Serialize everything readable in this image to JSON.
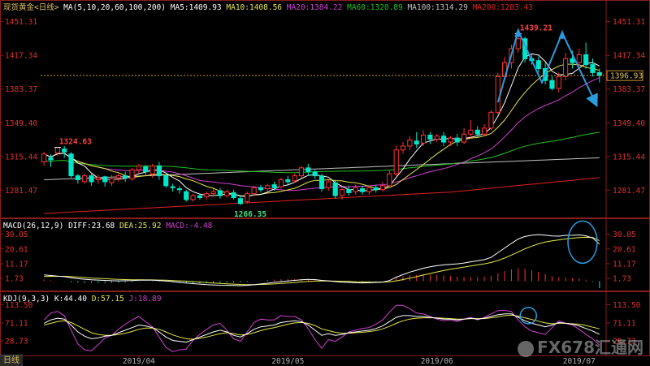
{
  "window": {
    "bottom_tab": "日线",
    "watermark": "FX678汇通网"
  },
  "colors": {
    "up": "#ff3232",
    "down": "#00e6c8",
    "ma5": "#ffffff",
    "ma10": "#e6e64b",
    "ma20": "#d040d0",
    "ma60": "#20c020",
    "ma100": "#c0c0c0",
    "ma200": "#e02020",
    "annotation": "#2b9be0",
    "price_line": "#c89632",
    "axis_text": "#e03030"
  },
  "chart_data": [
    {
      "type": "candlestick",
      "panel": "price",
      "title": "现货黄金<日线>",
      "ma_label": "MA(5,10,20,60,100,200)",
      "ma_values": [
        {
          "label": "MA5:1409.93",
          "color": "#ffffff"
        },
        {
          "label": "MA10:1408.56",
          "color": "#e6e64b"
        },
        {
          "label": "MA20:1384.22",
          "color": "#d040d0"
        },
        {
          "label": "MA60:1320.89",
          "color": "#20c020"
        },
        {
          "label": "MA100:1314.29",
          "color": "#c0c0c0"
        },
        {
          "label": "MA200:1283.43",
          "color": "#e02020"
        }
      ],
      "yticks": [
        1451.31,
        1417.34,
        1383.37,
        1349.4,
        1315.44,
        1281.47
      ],
      "ylim": [
        1254,
        1460
      ],
      "xticks": [
        {
          "label": "2019/04",
          "index": 14
        },
        {
          "label": "2019/05",
          "index": 36
        },
        {
          "label": "2019/06",
          "index": 58
        },
        {
          "label": "2019/07",
          "index": 79
        }
      ],
      "current_price": 1396.93,
      "annotations": [
        {
          "text": "1324.63",
          "index": 2,
          "value": 1324.63,
          "side": "above"
        },
        {
          "text": "1266.35",
          "index": 29,
          "value": 1266.35,
          "side": "below"
        },
        {
          "text": "1439.21",
          "index": 70,
          "value": 1439.21,
          "side": "above"
        }
      ],
      "candles": [
        [
          1310,
          1318,
          1306,
          1320
        ],
        [
          1314,
          1312,
          1305,
          1318
        ],
        [
          1319,
          1324.6,
          1316,
          1325
        ],
        [
          1323,
          1320,
          1314,
          1326
        ],
        [
          1318,
          1296,
          1294,
          1320
        ],
        [
          1296,
          1292,
          1288,
          1298
        ],
        [
          1290,
          1296,
          1288,
          1298
        ],
        [
          1296,
          1290,
          1286,
          1299
        ],
        [
          1292,
          1294,
          1288,
          1297
        ],
        [
          1295,
          1290,
          1285,
          1296
        ],
        [
          1289,
          1293,
          1286,
          1297
        ],
        [
          1294,
          1296,
          1290,
          1298
        ],
        [
          1296,
          1294,
          1290,
          1300
        ],
        [
          1293,
          1302,
          1291,
          1304
        ],
        [
          1302,
          1306,
          1299,
          1308
        ],
        [
          1305,
          1300,
          1297,
          1307
        ],
        [
          1298,
          1306,
          1294,
          1308
        ],
        [
          1306,
          1296,
          1292,
          1310
        ],
        [
          1296,
          1286,
          1284,
          1298
        ],
        [
          1285,
          1284,
          1280,
          1288
        ],
        [
          1283,
          1282,
          1278,
          1286
        ],
        [
          1280,
          1272,
          1270,
          1282
        ],
        [
          1272,
          1276,
          1270,
          1278
        ],
        [
          1276,
          1274,
          1272,
          1278
        ],
        [
          1275,
          1278,
          1272,
          1280
        ],
        [
          1278,
          1280,
          1275,
          1283
        ],
        [
          1281,
          1276,
          1273,
          1284
        ],
        [
          1276,
          1280,
          1274,
          1282
        ],
        [
          1279,
          1274,
          1272,
          1282
        ],
        [
          1273,
          1268,
          1266.4,
          1276
        ],
        [
          1270,
          1278,
          1268,
          1280
        ],
        [
          1278,
          1284,
          1276,
          1286
        ],
        [
          1284,
          1282,
          1279,
          1287
        ],
        [
          1283,
          1286,
          1280,
          1288
        ],
        [
          1287,
          1284,
          1281,
          1290
        ],
        [
          1285,
          1292,
          1283,
          1294
        ],
        [
          1292,
          1290,
          1287,
          1296
        ],
        [
          1291,
          1296,
          1289,
          1298
        ],
        [
          1296,
          1304,
          1294,
          1306
        ],
        [
          1304,
          1300,
          1296,
          1308
        ],
        [
          1300,
          1296,
          1293,
          1302
        ],
        [
          1296,
          1283,
          1280,
          1298
        ],
        [
          1284,
          1290,
          1281,
          1292
        ],
        [
          1289,
          1276,
          1273,
          1292
        ],
        [
          1276,
          1282,
          1272,
          1284
        ],
        [
          1282,
          1279,
          1276,
          1286
        ],
        [
          1280,
          1284,
          1277,
          1287
        ],
        [
          1283,
          1280,
          1277,
          1286
        ],
        [
          1280,
          1284,
          1277,
          1286
        ],
        [
          1284,
          1282,
          1279,
          1287
        ],
        [
          1282,
          1286,
          1280,
          1290
        ],
        [
          1286,
          1298,
          1284,
          1302
        ],
        [
          1298,
          1322,
          1296,
          1326
        ],
        [
          1322,
          1326,
          1318,
          1330
        ],
        [
          1326,
          1332,
          1322,
          1336
        ],
        [
          1331,
          1328,
          1324,
          1340
        ],
        [
          1329,
          1337,
          1326,
          1342
        ],
        [
          1337,
          1333,
          1328,
          1340
        ],
        [
          1333,
          1336,
          1330,
          1338
        ],
        [
          1336,
          1330,
          1326,
          1340
        ],
        [
          1330,
          1334,
          1326,
          1336
        ],
        [
          1334,
          1330,
          1326,
          1338
        ],
        [
          1330,
          1338,
          1328,
          1344
        ],
        [
          1338,
          1342,
          1334,
          1352
        ],
        [
          1342,
          1338,
          1334,
          1346
        ],
        [
          1338,
          1344,
          1336,
          1348
        ],
        [
          1344,
          1360,
          1342,
          1362
        ],
        [
          1360,
          1396,
          1358,
          1400
        ],
        [
          1396,
          1410,
          1394,
          1416
        ],
        [
          1410,
          1424,
          1404,
          1428
        ],
        [
          1424,
          1434,
          1420,
          1439.2
        ],
        [
          1434,
          1414,
          1410,
          1436
        ],
        [
          1414,
          1412,
          1408,
          1418
        ],
        [
          1412,
          1404,
          1400,
          1416
        ],
        [
          1404,
          1392,
          1388,
          1410
        ],
        [
          1392,
          1384,
          1382,
          1396
        ],
        [
          1384,
          1396,
          1380,
          1400
        ],
        [
          1396,
          1414,
          1392,
          1420
        ],
        [
          1414,
          1410,
          1404,
          1422
        ],
        [
          1410,
          1418,
          1406,
          1424
        ],
        [
          1418,
          1408,
          1404,
          1430
        ],
        [
          1408,
          1400,
          1396,
          1414
        ],
        [
          1400,
          1397,
          1390,
          1404
        ]
      ]
    },
    {
      "type": "line",
      "panel": "macd",
      "title": "MACD(26,12,9)",
      "values_label": [
        {
          "label": "DIFF:23.68",
          "color": "#ffffff"
        },
        {
          "label": "DEA:25.92",
          "color": "#e6e64b"
        },
        {
          "label": "MACD:-4.48",
          "color": "#d040d0"
        }
      ],
      "yticks": [
        30.05,
        20.61,
        11.17,
        1.73
      ],
      "ylim": [
        -6,
        34
      ],
      "diff": [
        4,
        3.6,
        3.2,
        2.9,
        2.2,
        1.6,
        1.2,
        0.9,
        0.7,
        0.5,
        0.3,
        0.2,
        0.3,
        0.4,
        0.6,
        0.7,
        0.6,
        0.4,
        0.1,
        -0.3,
        -0.8,
        -1.2,
        -1.6,
        -1.9,
        -2.2,
        -2.4,
        -2.6,
        -2.7,
        -2.8,
        -2.9,
        -2.7,
        -2.3,
        -1.8,
        -1.3,
        -0.8,
        -0.3,
        0.1,
        0.5,
        0.9,
        1.1,
        1.0,
        0.5,
        0.2,
        -0.3,
        -0.6,
        -0.8,
        -1.0,
        -1.1,
        -1.0,
        -0.8,
        -0.6,
        0.4,
        2.5,
        4.2,
        5.8,
        7.0,
        8.3,
        9.2,
        9.9,
        10.4,
        10.8,
        11.1,
        11.6,
        12.4,
        13.0,
        13.8,
        15.2,
        18.2,
        21.2,
        24.2,
        27.0,
        28.6,
        29.4,
        29.8,
        29.5,
        28.9,
        28.8,
        29.3,
        29.4,
        29.6,
        29.0,
        27.6,
        23.7
      ],
      "dea": [
        3.0,
        3.1,
        3.1,
        3.1,
        2.9,
        2.6,
        2.3,
        2.0,
        1.8,
        1.6,
        1.3,
        1.1,
        1.0,
        0.9,
        0.9,
        0.8,
        0.8,
        0.7,
        0.6,
        0.4,
        0.2,
        0.0,
        -0.3,
        -0.6,
        -0.9,
        -1.2,
        -1.5,
        -1.7,
        -1.9,
        -2.1,
        -2.2,
        -2.2,
        -2.1,
        -2.0,
        -1.8,
        -1.5,
        -1.2,
        -0.9,
        -0.5,
        -0.2,
        0.0,
        0.1,
        0.1,
        0.0,
        -0.1,
        -0.2,
        -0.4,
        -0.5,
        -0.6,
        -0.6,
        -0.6,
        -0.4,
        0.2,
        1.0,
        1.9,
        2.9,
        3.9,
        4.9,
        5.9,
        6.8,
        7.6,
        8.3,
        9.0,
        9.7,
        10.4,
        11.1,
        11.9,
        13.2,
        14.8,
        16.7,
        18.7,
        20.7,
        22.4,
        23.9,
        25.0,
        25.8,
        26.4,
        27.0,
        27.5,
        27.9,
        28.1,
        28.0,
        25.9
      ],
      "hist": [
        1.0,
        0.5,
        0.1,
        -0.2,
        -0.7,
        -1.0,
        -1.1,
        -1.1,
        -1.1,
        -1.1,
        -1.0,
        -0.9,
        -0.7,
        -0.5,
        -0.3,
        -0.1,
        -0.2,
        -0.3,
        -0.5,
        -0.7,
        -1.0,
        -1.2,
        -1.3,
        -1.3,
        -1.3,
        -1.2,
        -1.1,
        -1.0,
        -0.9,
        -0.8,
        -0.5,
        -0.1,
        0.3,
        0.7,
        1.0,
        1.2,
        1.3,
        1.4,
        1.4,
        1.3,
        1.0,
        0.4,
        0.1,
        -0.3,
        -0.5,
        -0.6,
        -0.6,
        -0.6,
        -0.4,
        -0.2,
        0.0,
        0.8,
        2.3,
        3.2,
        3.9,
        4.1,
        4.4,
        4.3,
        4.0,
        3.6,
        3.2,
        2.8,
        2.6,
        2.7,
        2.6,
        2.7,
        3.3,
        5.0,
        6.4,
        7.5,
        8.3,
        7.9,
        7.0,
        5.9,
        4.5,
        3.1,
        2.4,
        2.3,
        1.9,
        1.7,
        0.9,
        -0.4,
        -4.48
      ]
    },
    {
      "type": "line",
      "panel": "kdj",
      "title": "KDJ(9,3,3)",
      "values_label": [
        {
          "label": "K:44.40",
          "color": "#ffffff"
        },
        {
          "label": "D:57.15",
          "color": "#e6e64b"
        },
        {
          "label": "J:18.89",
          "color": "#d040d0"
        }
      ],
      "yticks": [
        113.5,
        71.11,
        28.73
      ],
      "ylim": [
        -5,
        122
      ],
      "k": [
        70,
        78,
        82,
        80,
        66,
        50,
        40,
        34,
        36,
        40,
        42,
        48,
        54,
        60,
        66,
        64,
        60,
        50,
        38,
        30,
        28,
        26,
        32,
        38,
        44,
        50,
        54,
        50,
        42,
        38,
        46,
        56,
        62,
        64,
        66,
        72,
        74,
        76,
        74,
        66,
        54,
        42,
        46,
        42,
        44,
        48,
        50,
        52,
        54,
        58,
        64,
        74,
        84,
        88,
        88,
        86,
        86,
        84,
        82,
        80,
        80,
        78,
        80,
        82,
        80,
        82,
        86,
        90,
        92,
        92,
        84,
        76,
        70,
        66,
        62,
        66,
        72,
        70,
        68,
        64,
        58,
        52,
        44.4
      ],
      "d": [
        66,
        70,
        74,
        76,
        72,
        64,
        56,
        48,
        44,
        42,
        42,
        44,
        47,
        51,
        56,
        59,
        59,
        56,
        50,
        43,
        38,
        34,
        33,
        35,
        38,
        42,
        46,
        48,
        46,
        43,
        44,
        48,
        53,
        57,
        60,
        64,
        68,
        71,
        72,
        70,
        65,
        57,
        53,
        49,
        47,
        47,
        48,
        49,
        51,
        53,
        57,
        63,
        70,
        76,
        80,
        82,
        83,
        83,
        83,
        82,
        81,
        80,
        80,
        81,
        81,
        81,
        83,
        85,
        88,
        89,
        87,
        83,
        79,
        75,
        71,
        69,
        70,
        70,
        69,
        68,
        65,
        61,
        57.15
      ],
      "j": [
        78,
        94,
        98,
        88,
        54,
        22,
        8,
        6,
        20,
        36,
        42,
        56,
        68,
        78,
        86,
        74,
        62,
        38,
        14,
        4,
        8,
        10,
        30,
        44,
        56,
        66,
        70,
        54,
        34,
        28,
        50,
        72,
        80,
        78,
        78,
        88,
        86,
        86,
        78,
        58,
        32,
        12,
        32,
        28,
        38,
        50,
        54,
        58,
        60,
        68,
        78,
        96,
        112,
        112,
        104,
        94,
        92,
        86,
        80,
        76,
        78,
        74,
        80,
        84,
        78,
        84,
        92,
        100,
        100,
        98,
        78,
        62,
        52,
        48,
        44,
        60,
        76,
        70,
        66,
        56,
        44,
        34,
        18.89
      ]
    }
  ],
  "markers": {
    "arrow_up_1_label": "rise arrow",
    "circle_macd_label": "macd circle",
    "circle_kdj_label": "kdj circle"
  }
}
